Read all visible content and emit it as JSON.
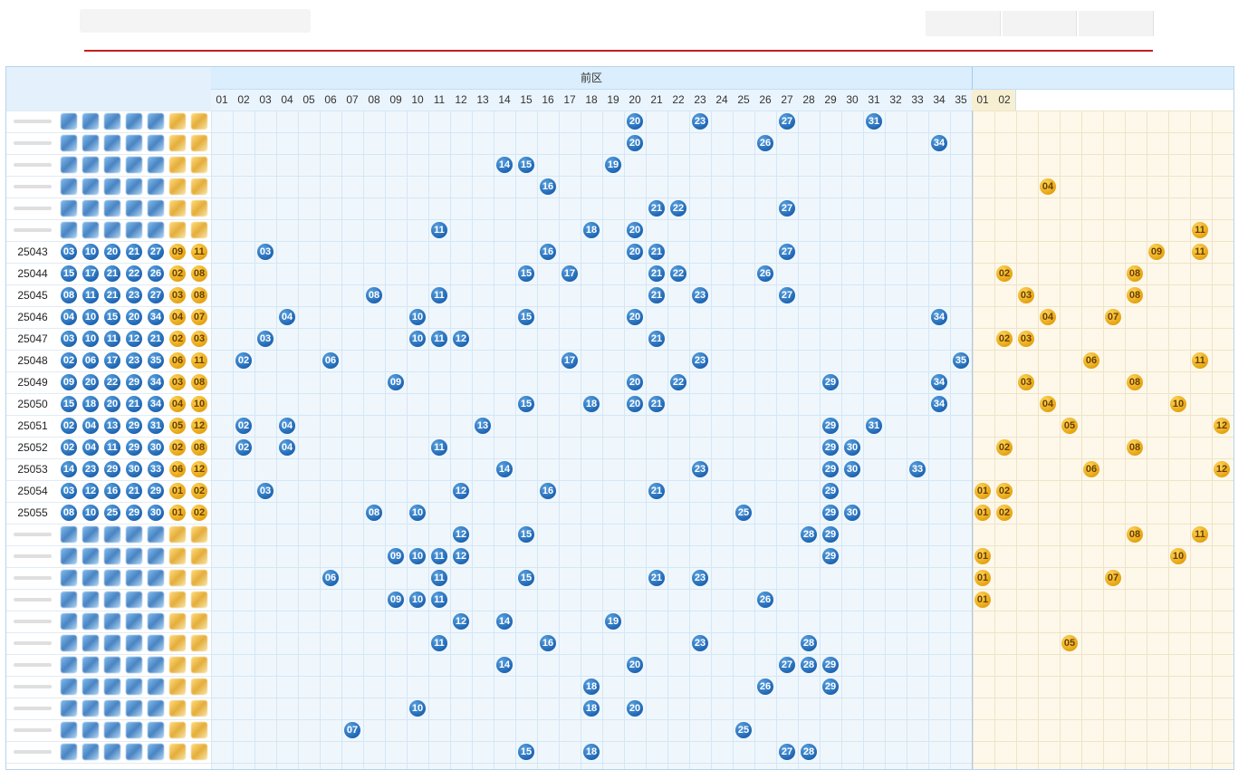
{
  "header": {
    "section_front": "前区"
  },
  "front_numbers": [
    "01",
    "02",
    "03",
    "04",
    "05",
    "06",
    "07",
    "08",
    "09",
    "10",
    "11",
    "12",
    "13",
    "14",
    "15",
    "16",
    "17",
    "18",
    "19",
    "20",
    "21",
    "22",
    "23",
    "24",
    "25",
    "26",
    "27",
    "28",
    "29",
    "30",
    "31",
    "32",
    "33",
    "34",
    "35"
  ],
  "back_numbers": [
    "01",
    "02"
  ],
  "colors": {
    "front_ball": "#1f66b4",
    "back_ball": "#e6a412",
    "top_rule": "#c81e1e"
  },
  "rows": [
    {
      "period": "",
      "front": [
        "20",
        "23",
        "27",
        "31"
      ],
      "back": []
    },
    {
      "period": "",
      "front": [
        "20",
        "26",
        "34"
      ],
      "back": []
    },
    {
      "period": "",
      "front": [
        "14",
        "15",
        "19"
      ],
      "back": []
    },
    {
      "period": "",
      "front": [
        "16"
      ],
      "back": [
        "04"
      ]
    },
    {
      "period": "",
      "front": [
        "21",
        "22",
        "27"
      ],
      "back": []
    },
    {
      "period": "",
      "front": [
        "11",
        "18",
        "20"
      ],
      "back": [
        "11"
      ]
    },
    {
      "period": "25043",
      "draw": [
        "03",
        "10",
        "20",
        "21",
        "27",
        "09",
        "11"
      ],
      "front": [
        "03",
        "16",
        "20",
        "21",
        "27"
      ],
      "back": [
        "09",
        "11"
      ]
    },
    {
      "period": "25044",
      "draw": [
        "15",
        "17",
        "21",
        "22",
        "26",
        "02",
        "08"
      ],
      "front": [
        "15",
        "17",
        "21",
        "22",
        "26"
      ],
      "back": [
        "02",
        "08"
      ]
    },
    {
      "period": "25045",
      "draw": [
        "08",
        "11",
        "21",
        "23",
        "27",
        "03",
        "08"
      ],
      "front": [
        "08",
        "11",
        "21",
        "23",
        "27"
      ],
      "back": [
        "03",
        "08"
      ]
    },
    {
      "period": "25046",
      "draw": [
        "04",
        "10",
        "15",
        "20",
        "34",
        "04",
        "07"
      ],
      "front": [
        "04",
        "10",
        "15",
        "20",
        "34"
      ],
      "back": [
        "04",
        "07"
      ]
    },
    {
      "period": "25047",
      "draw": [
        "03",
        "10",
        "11",
        "12",
        "21",
        "02",
        "03"
      ],
      "front": [
        "03",
        "10",
        "11",
        "12",
        "21"
      ],
      "back": [
        "02",
        "03"
      ]
    },
    {
      "period": "25048",
      "draw": [
        "02",
        "06",
        "17",
        "23",
        "35",
        "06",
        "11"
      ],
      "front": [
        "02",
        "06",
        "17",
        "23",
        "35"
      ],
      "back": [
        "06",
        "11"
      ]
    },
    {
      "period": "25049",
      "draw": [
        "09",
        "20",
        "22",
        "29",
        "34",
        "03",
        "08"
      ],
      "front": [
        "09",
        "20",
        "22",
        "29",
        "34"
      ],
      "back": [
        "03",
        "08"
      ]
    },
    {
      "period": "25050",
      "draw": [
        "15",
        "18",
        "20",
        "21",
        "34",
        "04",
        "10"
      ],
      "front": [
        "15",
        "18",
        "20",
        "21",
        "34"
      ],
      "back": [
        "04",
        "10"
      ]
    },
    {
      "period": "25051",
      "draw": [
        "02",
        "04",
        "13",
        "29",
        "31",
        "05",
        "12"
      ],
      "front": [
        "02",
        "04",
        "13",
        "29",
        "31"
      ],
      "back": [
        "05",
        "12"
      ]
    },
    {
      "period": "25052",
      "draw": [
        "02",
        "04",
        "11",
        "29",
        "30",
        "02",
        "08"
      ],
      "front": [
        "02",
        "04",
        "11",
        "29",
        "30"
      ],
      "back": [
        "02",
        "08"
      ]
    },
    {
      "period": "25053",
      "draw": [
        "14",
        "23",
        "29",
        "30",
        "33",
        "06",
        "12"
      ],
      "front": [
        "14",
        "23",
        "29",
        "30",
        "33"
      ],
      "back": [
        "06",
        "12"
      ]
    },
    {
      "period": "25054",
      "draw": [
        "03",
        "12",
        "16",
        "21",
        "29",
        "01",
        "02"
      ],
      "front": [
        "03",
        "12",
        "16",
        "21",
        "29"
      ],
      "back": [
        "01",
        "02"
      ]
    },
    {
      "period": "25055",
      "draw": [
        "08",
        "10",
        "25",
        "29",
        "30",
        "01",
        "02"
      ],
      "front": [
        "08",
        "10",
        "25",
        "29",
        "30"
      ],
      "back": [
        "01",
        "02"
      ]
    },
    {
      "period": "",
      "front": [
        "12",
        "15",
        "28",
        "29"
      ],
      "back": [
        "08",
        "11"
      ]
    },
    {
      "period": "",
      "front": [
        "09",
        "10",
        "11",
        "12",
        "29"
      ],
      "back": [
        "01",
        "10"
      ]
    },
    {
      "period": "",
      "front": [
        "06",
        "11",
        "15",
        "21",
        "23"
      ],
      "back": [
        "01",
        "07"
      ]
    },
    {
      "period": "",
      "front": [
        "09",
        "10",
        "11",
        "26"
      ],
      "back": [
        "01"
      ]
    },
    {
      "period": "",
      "front": [
        "12",
        "14",
        "19"
      ],
      "back": []
    },
    {
      "period": "",
      "front": [
        "11",
        "16",
        "23",
        "28"
      ],
      "back": [
        "05"
      ]
    },
    {
      "period": "",
      "front": [
        "14",
        "20",
        "27",
        "28",
        "29"
      ],
      "back": []
    },
    {
      "period": "",
      "front": [
        "18",
        "26",
        "29"
      ],
      "back": []
    },
    {
      "period": "",
      "front": [
        "10",
        "18",
        "20"
      ],
      "back": []
    },
    {
      "period": "",
      "front": [
        "07",
        "25"
      ],
      "back": []
    },
    {
      "period": "",
      "front": [
        "15",
        "18",
        "27",
        "28"
      ],
      "back": []
    }
  ]
}
